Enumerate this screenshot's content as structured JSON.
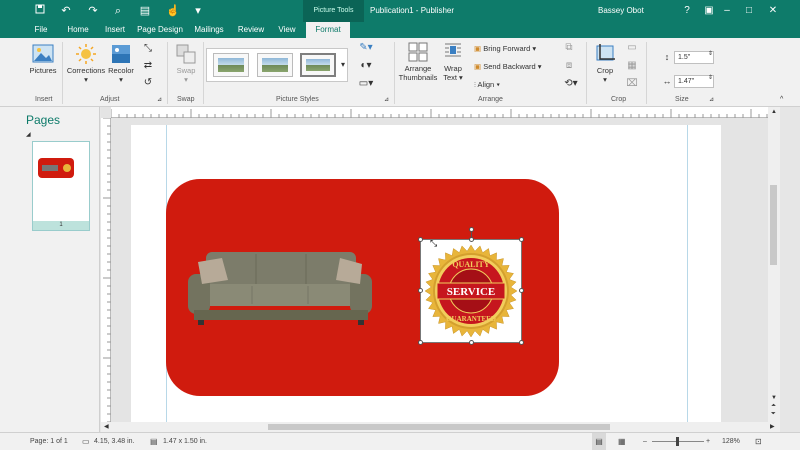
{
  "titlebar": {
    "context_tab": "Picture Tools",
    "title": "Publication1 - Publisher",
    "user": "Bassey Obot",
    "help": "?",
    "quick_access": [
      "save-icon",
      "undo-icon",
      "redo-icon",
      "print-preview-icon"
    ]
  },
  "tabs": [
    "File",
    "Home",
    "Insert",
    "Page Design",
    "Mailings",
    "Review",
    "View",
    "Format"
  ],
  "ribbon": {
    "insert": {
      "pictures": "Pictures",
      "label": "Insert"
    },
    "adjust": {
      "corrections": "Corrections",
      "recolor": "Recolor",
      "label": "Adjust"
    },
    "swap": {
      "swap": "Swap",
      "label": "Swap"
    },
    "picture_styles": {
      "label": "Picture Styles"
    },
    "arrange": {
      "arrange_thumbnails_1": "Arrange",
      "arrange_thumbnails_2": "Thumbnails",
      "wrap_text_1": "Wrap",
      "wrap_text_2": "Text",
      "bring_forward": "Bring Forward",
      "send_backward": "Send Backward",
      "align": "Align",
      "label": "Arrange"
    },
    "crop": {
      "crop": "Crop",
      "label": "Crop"
    },
    "size": {
      "height": "1.5\"",
      "width": "1.47\"",
      "label": "Size"
    }
  },
  "pages_pane": {
    "title": "Pages",
    "page_number": "1"
  },
  "seal": {
    "top_text": "QUALITY",
    "middle_text": "SERVICE",
    "bottom_text": "GUARANTEED"
  },
  "status": {
    "page": "Page: 1 of 1",
    "position": "4.15, 3.48 in.",
    "size": "1.47 x 1.50 in.",
    "zoom": "128%"
  },
  "colors": {
    "accent": "#0e7b6a",
    "red_shape": "#d01b0e",
    "gold": "#e8b53a"
  }
}
